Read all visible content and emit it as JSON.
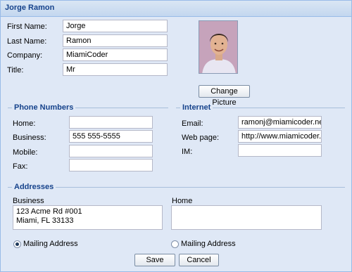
{
  "window": {
    "title": "Jorge Ramon"
  },
  "contact": {
    "first_name_label": "First Name:",
    "first_name": "Jorge",
    "last_name_label": "Last Name:",
    "last_name": "Ramon",
    "company_label": "Company:",
    "company": "MiamiCoder",
    "title_label": "Title:",
    "title": "Mr",
    "change_picture_label": "Change Picture"
  },
  "phones": {
    "legend": "Phone Numbers",
    "home_label": "Home:",
    "home": "",
    "business_label": "Business:",
    "business": "555 555-5555",
    "mobile_label": "Mobile:",
    "mobile": "",
    "fax_label": "Fax:",
    "fax": ""
  },
  "internet": {
    "legend": "Internet",
    "email_label": "Email:",
    "email": "ramonj@miamicoder.net",
    "webpage_label": "Web page:",
    "webpage": "http://www.miamicoder.co",
    "im_label": "IM:",
    "im": ""
  },
  "addresses": {
    "legend": "Addresses",
    "business_label": "Business",
    "business_lines": [
      "123 Acme Rd #001",
      "Miami, FL 33133"
    ],
    "home_label": "Home",
    "home_lines": [],
    "mailing_label_business": "Mailing Address",
    "mailing_label_home": "Mailing Address",
    "mailing_selected": "business"
  },
  "actions": {
    "save_label": "Save",
    "cancel_label": "Cancel"
  },
  "colors": {
    "title_text": "#15428b",
    "panel_bg": "#dfe8f6",
    "border": "#99bbe8"
  }
}
